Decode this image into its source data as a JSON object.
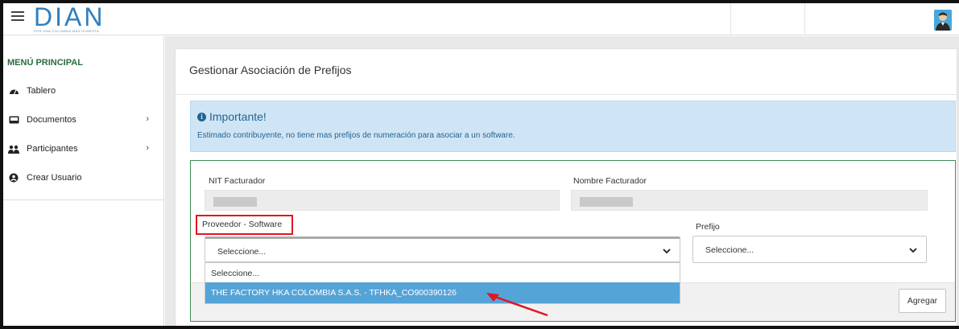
{
  "header": {
    "logo_text": "DIAN",
    "logo_tagline": "POR UNA COLOMBIA MÁS HONESTA"
  },
  "sidebar": {
    "title": "MENÚ PRINCIPAL",
    "items": [
      {
        "label": "Tablero",
        "icon": "dashboard-icon"
      },
      {
        "label": "Documentos",
        "icon": "inbox-icon",
        "chevron": "›"
      },
      {
        "label": "Participantes",
        "icon": "users-icon",
        "chevron": "›"
      },
      {
        "label": "Crear Usuario",
        "icon": "user-circle-icon"
      }
    ]
  },
  "main": {
    "title": "Gestionar Asociación de Prefijos",
    "alert": {
      "heading": "Importante!",
      "message": "Estimado contribuyente, no tiene mas prefijos de numeración para asociar a un software."
    },
    "form": {
      "nit_label": "NIT Facturador",
      "nombre_label": "Nombre Facturador",
      "proveedor_label": "Proveedor - Software",
      "proveedor_value": "Seleccione...",
      "prefijo_label": "Prefijo",
      "prefijo_value": "Seleccione...",
      "proveedor_options": [
        "Seleccione...",
        "THE FACTORY HKA COLOMBIA S.A.S. - TFHKA_CO900390126"
      ],
      "agregar_label": "Agregar"
    }
  },
  "colors": {
    "brand_green": "#2a6b3f",
    "brand_blue": "#2e7fc0",
    "alert_bg": "#cfe5f6",
    "selected_option": "#55a4d8",
    "highlight_red": "#e0171f",
    "form_border": "#3e8e54"
  }
}
